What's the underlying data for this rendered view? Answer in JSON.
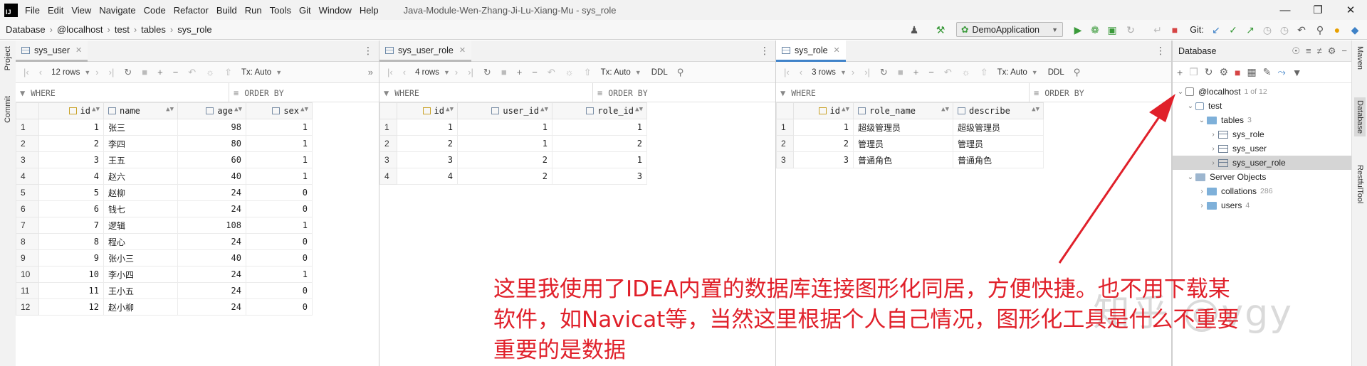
{
  "menubar": {
    "logo": "IJ",
    "items": [
      "File",
      "Edit",
      "View",
      "Navigate",
      "Code",
      "Refactor",
      "Build",
      "Run",
      "Tools",
      "Git",
      "Window",
      "Help"
    ],
    "window_title": "Java-Module-Wen-Zhang-Ji-Lu-Xiang-Mu - sys_role"
  },
  "breadcrumb": [
    "Database",
    "@localhost",
    "test",
    "tables",
    "sys_role"
  ],
  "run_config": "DemoApplication",
  "git_label": "Git:",
  "left_strip": {
    "project": "Project",
    "commit": "Commit"
  },
  "right_strip": {
    "maven": "Maven",
    "database": "Database",
    "restful": "RestfulTool"
  },
  "pane_common": {
    "where": "WHERE",
    "order_by": "ORDER BY",
    "tx": "Tx: Auto",
    "ddl": "DDL"
  },
  "panes": [
    {
      "tab": "sys_user",
      "rows_label": "12 rows",
      "columns": [
        "id",
        "name",
        "age",
        "sex"
      ],
      "rows": [
        [
          "1",
          "1",
          "张三",
          "98",
          "1"
        ],
        [
          "2",
          "2",
          "李四",
          "80",
          "1"
        ],
        [
          "3",
          "3",
          "王五",
          "60",
          "1"
        ],
        [
          "4",
          "4",
          "赵六",
          "40",
          "1"
        ],
        [
          "5",
          "5",
          "赵柳",
          "24",
          "0"
        ],
        [
          "6",
          "6",
          "钱七",
          "24",
          "0"
        ],
        [
          "7",
          "7",
          "逻辑",
          "108",
          "1"
        ],
        [
          "8",
          "8",
          "程心",
          "24",
          "0"
        ],
        [
          "9",
          "9",
          "张小三",
          "40",
          "0"
        ],
        [
          "10",
          "10",
          "李小四",
          "24",
          "1"
        ],
        [
          "11",
          "11",
          "王小五",
          "24",
          "0"
        ],
        [
          "12",
          "12",
          "赵小柳",
          "24",
          "0"
        ]
      ]
    },
    {
      "tab": "sys_user_role",
      "rows_label": "4 rows",
      "columns": [
        "id",
        "user_id",
        "role_id"
      ],
      "rows": [
        [
          "1",
          "1",
          "1",
          "1"
        ],
        [
          "2",
          "2",
          "1",
          "2"
        ],
        [
          "3",
          "3",
          "2",
          "1"
        ],
        [
          "4",
          "4",
          "2",
          "3"
        ]
      ]
    },
    {
      "tab": "sys_role",
      "rows_label": "3 rows",
      "columns": [
        "id",
        "role_name",
        "describe"
      ],
      "rows": [
        [
          "1",
          "1",
          "超级管理员",
          "超级管理员"
        ],
        [
          "2",
          "2",
          "管理员",
          "管理员"
        ],
        [
          "3",
          "3",
          "普通角色",
          "普通角色"
        ]
      ]
    }
  ],
  "db_panel": {
    "title": "Database",
    "tree": [
      {
        "label": "@localhost",
        "count": "1 of 12"
      },
      {
        "label": "test",
        "count": ""
      },
      {
        "label": "tables",
        "count": "3"
      },
      {
        "label": "sys_role",
        "count": ""
      },
      {
        "label": "sys_user",
        "count": ""
      },
      {
        "label": "sys_user_role",
        "count": ""
      },
      {
        "label": "Server Objects",
        "count": ""
      },
      {
        "label": "collations",
        "count": "286"
      },
      {
        "label": "users",
        "count": "4"
      }
    ]
  },
  "annotation": {
    "line1": "这里我使用了IDEA内置的数据库连接图形化同居，方便快捷。也不用下载某",
    "line2": "软件，如Navicat等，当然这里根据个人自己情况，图形化工具是什么不重要",
    "line3": "重要的是数据"
  },
  "watermark": "知乎 @vgy",
  "colors": {
    "annotation": "#e0202a",
    "accent": "#4083c9",
    "run_green": "#3a9a3a"
  }
}
